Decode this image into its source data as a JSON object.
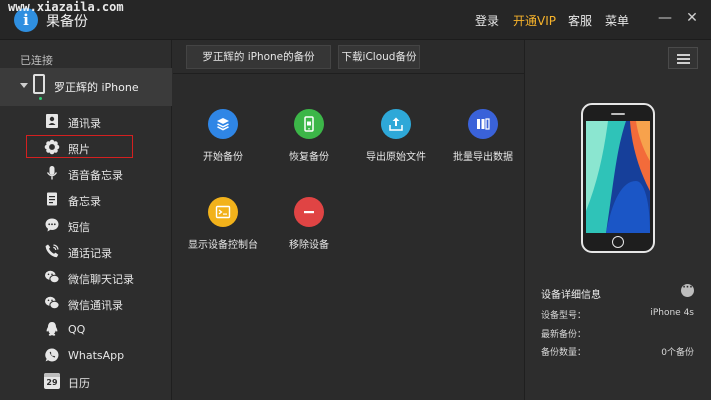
{
  "watermark": "www.xiazaila.com",
  "titlebar": {
    "app_name": "果备份",
    "logo_char": "i",
    "menu": {
      "login": "登录",
      "vip": "开通VIP",
      "service": "客服",
      "menu": "菜单"
    },
    "minimize": "—",
    "close": "✕"
  },
  "sidebar": {
    "connected_label": "已连接",
    "device_name": "罗正辉的 iPhone",
    "items": [
      {
        "label": "通讯录",
        "icon": "contacts-icon"
      },
      {
        "label": "照片",
        "icon": "photos-icon"
      },
      {
        "label": "语音备忘录",
        "icon": "microphone-icon"
      },
      {
        "label": "备忘录",
        "icon": "notes-icon"
      },
      {
        "label": "短信",
        "icon": "message-icon"
      },
      {
        "label": "通话记录",
        "icon": "phone-call-icon"
      },
      {
        "label": "微信聊天记录",
        "icon": "wechat-icon"
      },
      {
        "label": "微信通讯录",
        "icon": "wechat-contacts-icon"
      },
      {
        "label": "QQ",
        "icon": "qq-icon"
      },
      {
        "label": "WhatsApp",
        "icon": "whatsapp-icon"
      },
      {
        "label": "日历",
        "icon": "calendar-icon"
      }
    ],
    "calendar_day": "29"
  },
  "main": {
    "tabs": [
      {
        "label": "罗正辉的 iPhone的备份"
      },
      {
        "label": "下载iCloud备份"
      }
    ],
    "actions": [
      {
        "label": "开始备份",
        "icon": "layers-icon",
        "color": "#2f86e6"
      },
      {
        "label": "恢复备份",
        "icon": "phone-restore-icon",
        "color": "#3cb648"
      },
      {
        "label": "导出原始文件",
        "icon": "export-icon",
        "color": "#2ea8d8"
      },
      {
        "label": "批量导出数据",
        "icon": "batch-export-icon",
        "color": "#3a62d9"
      },
      {
        "label": "显示设备控制台",
        "icon": "console-icon",
        "color": "#f2b21b"
      },
      {
        "label": "移除设备",
        "icon": "remove-icon",
        "color": "#e04444"
      }
    ]
  },
  "right_panel": {
    "info_title": "设备详细信息",
    "more": "···",
    "rows": [
      {
        "label": "设备型号：",
        "value": "iPhone 4s"
      },
      {
        "label": "最新备份：",
        "value": ""
      },
      {
        "label": "备份数量：",
        "value": "0个备份"
      }
    ]
  }
}
